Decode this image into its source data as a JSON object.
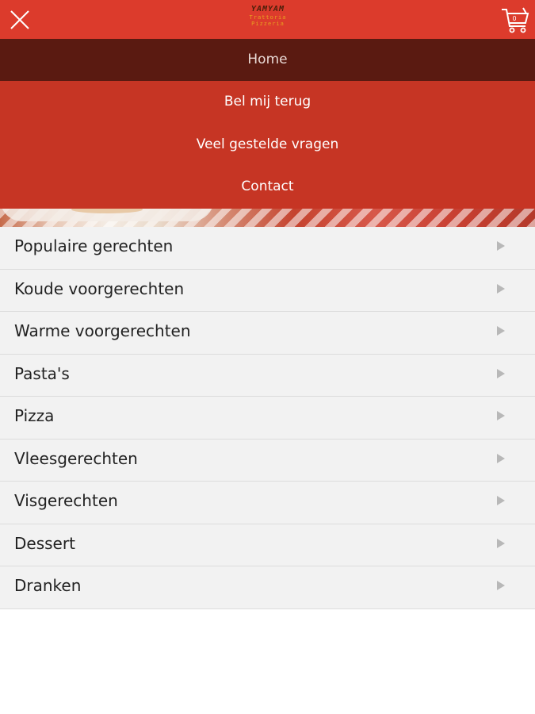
{
  "header": {
    "logo_line1": "YAMYAM",
    "logo_line2": "Trattoria",
    "logo_line3": "Pizzeria",
    "cart_count": "0"
  },
  "menu": {
    "home": "Home",
    "items": [
      "Bel mij terug",
      "Veel gestelde vragen",
      "Contact"
    ]
  },
  "categories": [
    "Populaire gerechten",
    "Koude voorgerechten",
    "Warme voorgerechten",
    "Pasta's",
    "Pizza",
    "Vleesgerechten",
    "Visgerechten",
    "Dessert",
    "Dranken"
  ],
  "colors": {
    "header": "#dc3b2c",
    "menu_active": "#5a1a11",
    "menu": "#c63524",
    "list_bg": "#f2f2f2"
  },
  "icons": [
    "close-icon",
    "cart-icon",
    "chevron-right-icon"
  ]
}
